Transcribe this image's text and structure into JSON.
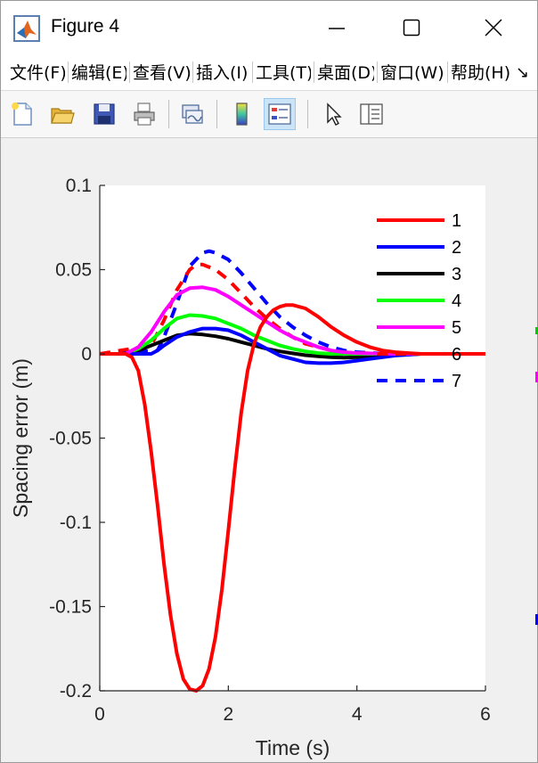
{
  "window": {
    "title": "Figure 4"
  },
  "menu": {
    "items": [
      "文件(F)",
      "编辑(E)",
      "查看(V)",
      "插入(I)",
      "工具(T)",
      "桌面(D)",
      "窗口(W)",
      "帮助(H)"
    ]
  },
  "toolbar": {
    "buttons": [
      "new-figure",
      "open-file",
      "save-figure",
      "print-figure",
      "link-plot",
      "insert-colorbar",
      "insert-legend",
      "edit-plot",
      "property-inspector"
    ]
  },
  "colors": {
    "series_1": "#ff0000",
    "series_2": "#0000ff",
    "series_3": "#000000",
    "series_4": "#00ff00",
    "series_5": "#ff00ff",
    "series_6": "#ff0000",
    "series_7": "#0000ff"
  },
  "chart_data": {
    "type": "line",
    "title": "",
    "xlabel": "Time (s)",
    "ylabel": "Spacing error (m)",
    "xlim": [
      0,
      6
    ],
    "ylim": [
      -0.2,
      0.1
    ],
    "xticks": [
      "0",
      "2",
      "4",
      "6"
    ],
    "yticks": [
      "-0.2",
      "-0.15",
      "-0.1",
      "-0.05",
      "0",
      "0.05",
      "0.1"
    ],
    "grid": false,
    "legend_position": "top-right",
    "series": [
      {
        "name": "1",
        "style": "solid",
        "color": "#ff0000",
        "x": [
          0,
          0.4,
          0.5,
          0.6,
          0.7,
          0.8,
          0.9,
          1.0,
          1.1,
          1.2,
          1.3,
          1.4,
          1.5,
          1.6,
          1.7,
          1.8,
          1.9,
          2.0,
          2.1,
          2.2,
          2.3,
          2.4,
          2.5,
          2.6,
          2.7,
          2.8,
          2.9,
          3.0,
          3.2,
          3.4,
          3.6,
          3.8,
          4.0,
          4.2,
          4.4,
          4.6,
          4.8,
          5.0,
          5.5,
          6.0
        ],
        "y": [
          0,
          0,
          -0.002,
          -0.01,
          -0.03,
          -0.058,
          -0.09,
          -0.125,
          -0.155,
          -0.178,
          -0.193,
          -0.199,
          -0.2,
          -0.197,
          -0.187,
          -0.168,
          -0.14,
          -0.105,
          -0.068,
          -0.035,
          -0.01,
          0.006,
          0.016,
          0.022,
          0.026,
          0.028,
          0.029,
          0.029,
          0.027,
          0.022,
          0.016,
          0.011,
          0.007,
          0.004,
          0.002,
          0.001,
          0.0005,
          0,
          0,
          0
        ]
      },
      {
        "name": "2",
        "style": "solid",
        "color": "#0000ff",
        "x": [
          0,
          0.8,
          0.9,
          1.0,
          1.2,
          1.4,
          1.6,
          1.8,
          2.0,
          2.2,
          2.4,
          2.6,
          2.8,
          3.0,
          3.2,
          3.4,
          3.6,
          3.8,
          4.0,
          4.2,
          4.4,
          4.6,
          5.0,
          5.5,
          6.0
        ],
        "y": [
          0,
          0,
          0.002,
          0.005,
          0.01,
          0.013,
          0.015,
          0.015,
          0.014,
          0.011,
          0.007,
          0.003,
          -0.001,
          -0.003,
          -0.005,
          -0.0055,
          -0.0055,
          -0.005,
          -0.004,
          -0.003,
          -0.002,
          -0.001,
          0,
          0,
          0
        ]
      },
      {
        "name": "3",
        "style": "solid",
        "color": "#000000",
        "x": [
          0,
          0.4,
          0.6,
          0.8,
          1.0,
          1.2,
          1.4,
          1.6,
          1.8,
          2.0,
          2.2,
          2.4,
          2.6,
          2.8,
          3.0,
          3.2,
          3.4,
          3.6,
          3.8,
          4.0,
          4.5,
          5.0,
          6.0
        ],
        "y": [
          0,
          0,
          0.002,
          0.005,
          0.008,
          0.011,
          0.012,
          0.0115,
          0.0105,
          0.009,
          0.007,
          0.005,
          0.003,
          0.0015,
          0.0003,
          -0.0008,
          -0.0015,
          -0.002,
          -0.0022,
          -0.002,
          -0.001,
          0,
          0
        ]
      },
      {
        "name": "4",
        "style": "solid",
        "color": "#00ff00",
        "x": [
          0,
          0.4,
          0.6,
          0.8,
          1.0,
          1.2,
          1.4,
          1.6,
          1.8,
          2.0,
          2.2,
          2.4,
          2.6,
          2.8,
          3.0,
          3.2,
          3.4,
          3.6,
          4.0,
          4.5,
          5.0,
          6.0
        ],
        "y": [
          0,
          0,
          0.003,
          0.008,
          0.015,
          0.021,
          0.023,
          0.0225,
          0.021,
          0.018,
          0.015,
          0.011,
          0.008,
          0.005,
          0.003,
          0.0015,
          0.0005,
          0,
          0,
          0,
          0,
          0
        ]
      },
      {
        "name": "5",
        "style": "solid",
        "color": "#ff00ff",
        "x": [
          0,
          0.4,
          0.6,
          0.8,
          1.0,
          1.2,
          1.4,
          1.6,
          1.8,
          2.0,
          2.2,
          2.4,
          2.6,
          2.8,
          3.0,
          3.2,
          3.4,
          3.6,
          3.8,
          4.0,
          4.5,
          5.0,
          6.0
        ],
        "y": [
          0,
          0,
          0.004,
          0.013,
          0.025,
          0.035,
          0.039,
          0.0395,
          0.038,
          0.034,
          0.029,
          0.024,
          0.019,
          0.014,
          0.01,
          0.007,
          0.004,
          0.002,
          0.001,
          0.0005,
          0,
          0,
          0
        ]
      },
      {
        "name": "6",
        "style": "dashed",
        "color": "#ff0000",
        "x": [
          0,
          0.8,
          1.0,
          1.2,
          1.4,
          1.5,
          1.6,
          1.8,
          2.0,
          2.2,
          2.4,
          2.6,
          2.8,
          3.0,
          3.2,
          3.4,
          3.6,
          3.8,
          4.0,
          4.5,
          5.0,
          6.0
        ],
        "y": [
          0,
          0.005,
          0.02,
          0.038,
          0.05,
          0.053,
          0.053,
          0.05,
          0.044,
          0.036,
          0.028,
          0.021,
          0.015,
          0.01,
          0.006,
          0.004,
          0.002,
          0.001,
          0.0005,
          0,
          0,
          0
        ]
      },
      {
        "name": "7",
        "style": "dashed",
        "color": "#0000ff",
        "x": [
          0,
          0.9,
          1.0,
          1.2,
          1.4,
          1.6,
          1.7,
          1.8,
          2.0,
          2.2,
          2.4,
          2.6,
          2.8,
          3.0,
          3.2,
          3.4,
          3.6,
          3.8,
          4.0,
          4.5,
          5.0,
          6.0
        ],
        "y": [
          0,
          0.002,
          0.01,
          0.03,
          0.052,
          0.06,
          0.061,
          0.06,
          0.056,
          0.048,
          0.039,
          0.03,
          0.022,
          0.016,
          0.011,
          0.007,
          0.004,
          0.002,
          0.001,
          0,
          0,
          0
        ]
      }
    ]
  }
}
